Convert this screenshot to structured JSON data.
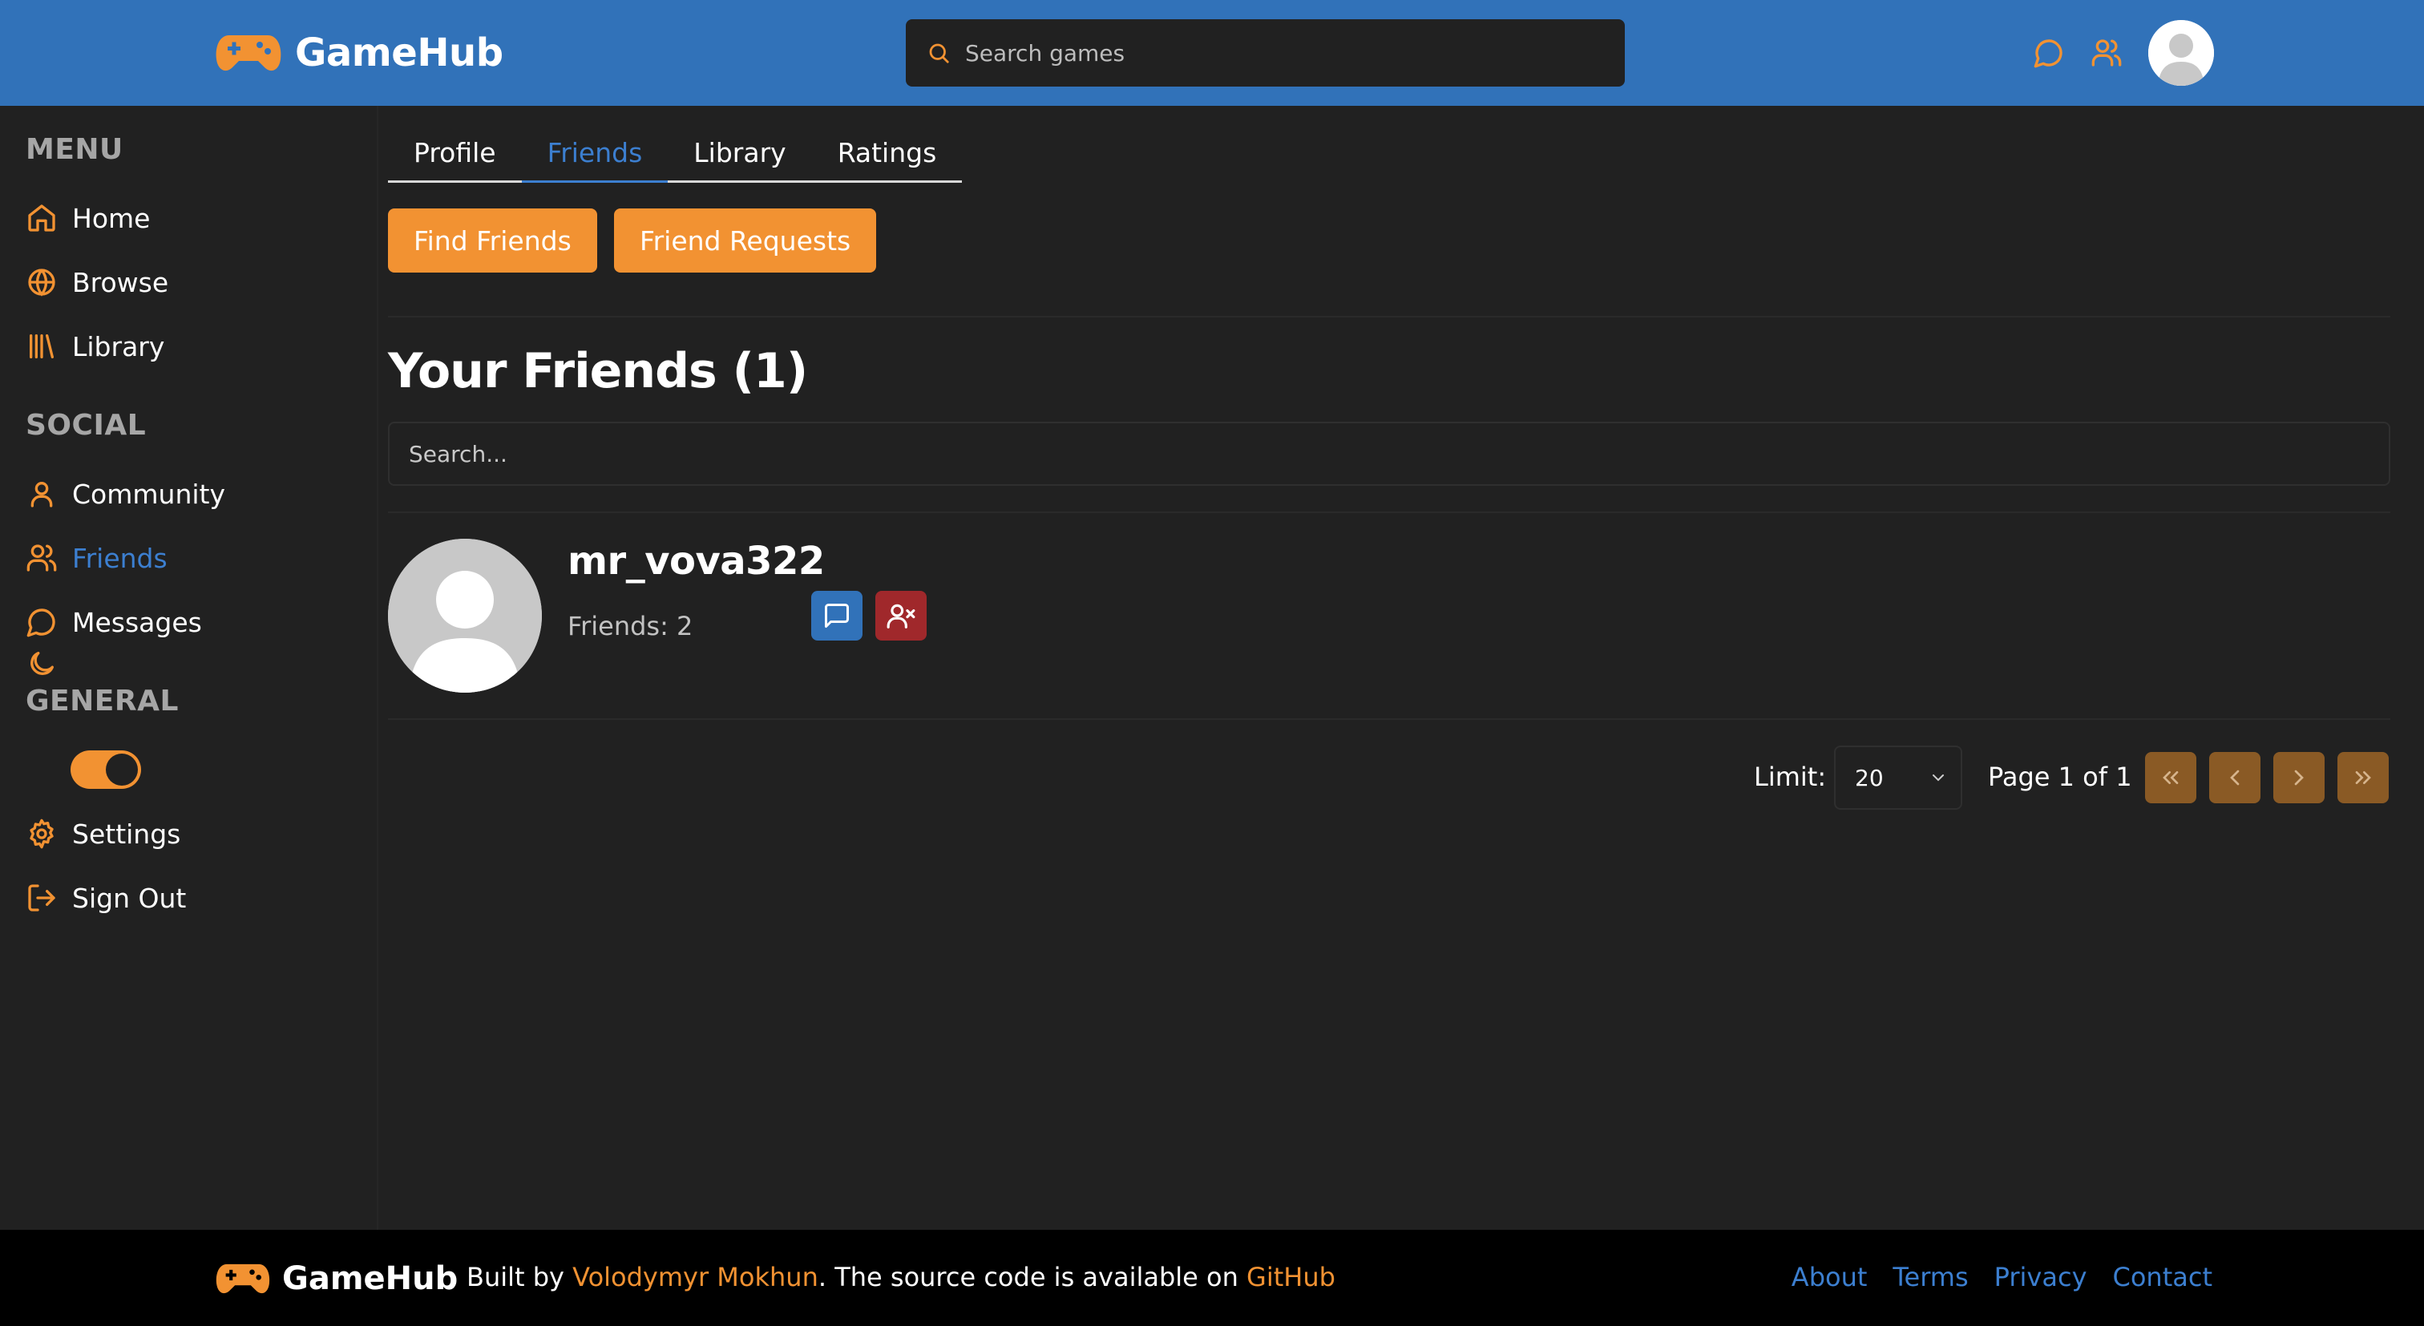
{
  "header": {
    "brand": "GameHub",
    "search_placeholder": "Search games"
  },
  "sidebar": {
    "sections": [
      {
        "title": "MENU",
        "items": [
          {
            "label": "Home",
            "icon": "home-icon"
          },
          {
            "label": "Browse",
            "icon": "globe-icon"
          },
          {
            "label": "Library",
            "icon": "library-icon"
          }
        ]
      },
      {
        "title": "SOCIAL",
        "items": [
          {
            "label": "Community",
            "icon": "user-icon"
          },
          {
            "label": "Friends",
            "icon": "users-icon",
            "active": true
          },
          {
            "label": "Messages",
            "icon": "message-icon"
          }
        ]
      },
      {
        "title": "GENERAL",
        "items": [
          {
            "label": "Settings",
            "icon": "gear-icon"
          },
          {
            "label": "Sign Out",
            "icon": "sign-out-icon"
          }
        ]
      }
    ],
    "dark_mode_on": true
  },
  "tabs": [
    {
      "label": "Profile"
    },
    {
      "label": "Friends",
      "active": true
    },
    {
      "label": "Library"
    },
    {
      "label": "Ratings"
    }
  ],
  "actions": {
    "find_friends": "Find Friends",
    "friend_requests": "Friend Requests"
  },
  "friends": {
    "heading": "Your Friends (1)",
    "search_placeholder": "Search...",
    "list": [
      {
        "username": "mr_vova322",
        "friends_count_text": "Friends: 2"
      }
    ]
  },
  "pagination": {
    "limit_label": "Limit:",
    "limit_value": "20",
    "page_text": "Page 1 of 1"
  },
  "footer": {
    "brand": "GameHub",
    "built_by_prefix": "Built by ",
    "author": "Volodymyr Mokhun",
    "source_text": ". The source code is available on ",
    "github": "GitHub",
    "links": [
      "About",
      "Terms",
      "Privacy",
      "Contact"
    ]
  },
  "colors": {
    "header_bg": "#3172b9",
    "accent_orange": "#f29232",
    "accent_blue": "#3c7fd0",
    "page_bg": "#212121",
    "danger": "#a0282b",
    "footer_bg": "#000000"
  }
}
